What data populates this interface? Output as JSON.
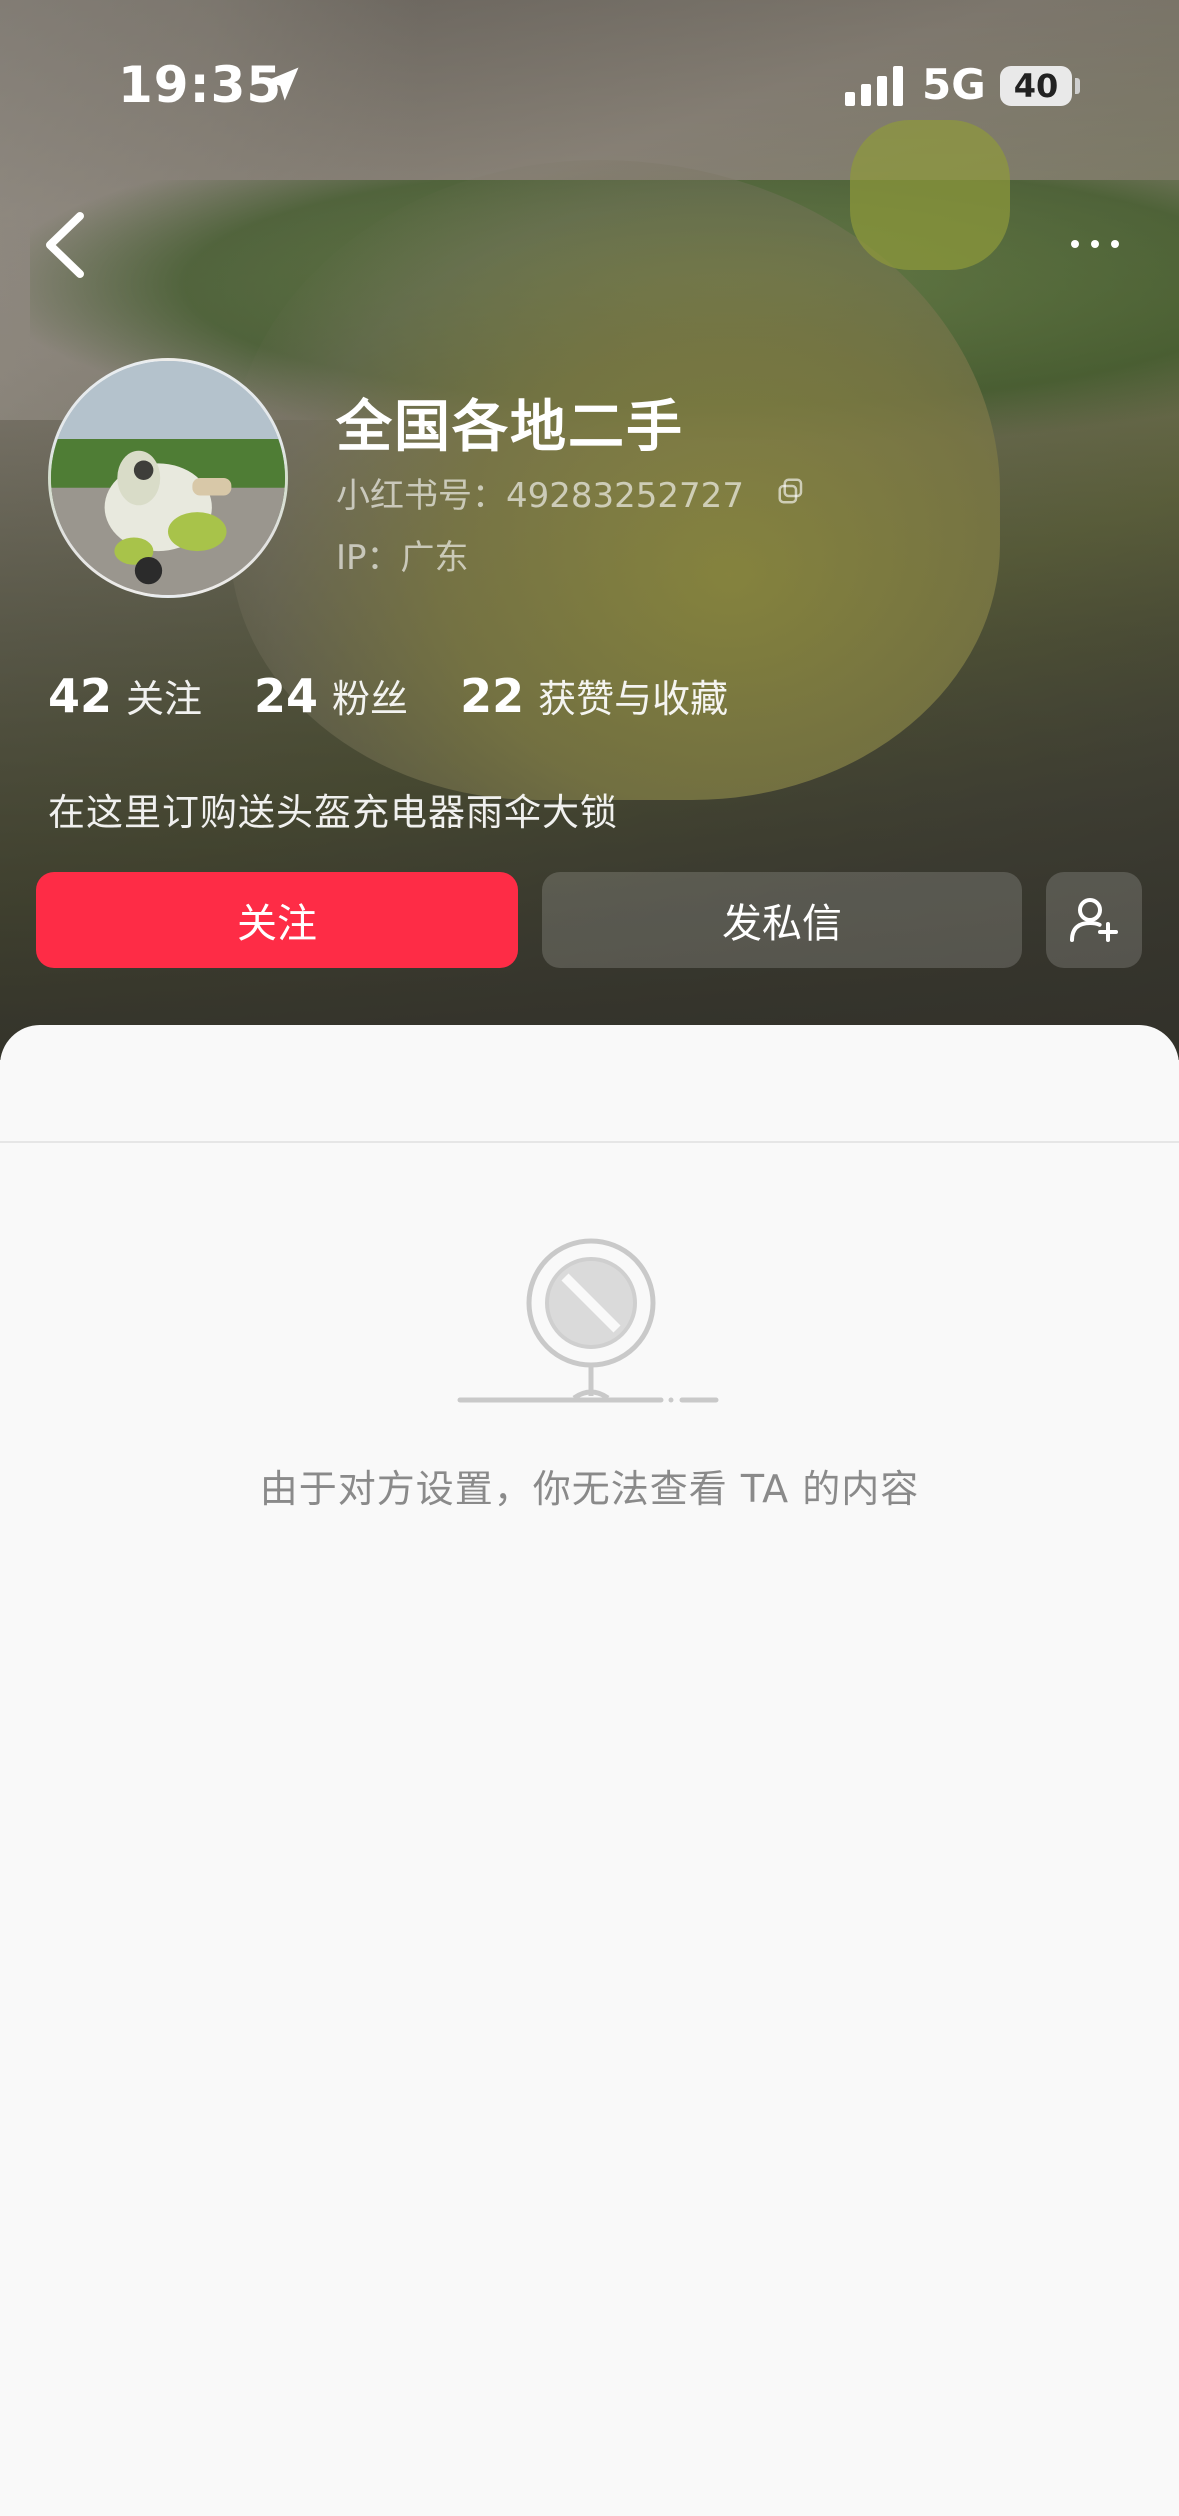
{
  "status_bar": {
    "time": "19:35",
    "network": "5G",
    "battery": "40",
    "icons": [
      "location-arrow-icon",
      "cellular-signal-icon",
      "battery-icon"
    ]
  },
  "nav": {
    "back_icon": "chevron-left-icon",
    "more_icon": "more-dots-icon"
  },
  "profile": {
    "nickname": "全国各地二手",
    "uid_label": "小红书号：",
    "uid": "49283252727",
    "ip_label": "IP：",
    "ip": "广东",
    "bio": "在这里订购送头盔充电器雨伞大锁"
  },
  "stats": [
    {
      "num": "42",
      "label": "关注"
    },
    {
      "num": "24",
      "label": "粉丝"
    },
    {
      "num": "22",
      "label": "获赞与收藏"
    }
  ],
  "actions": {
    "follow": "关注",
    "message": "发私信",
    "add_friend_icon": "add-user-icon"
  },
  "colors": {
    "accent": "#fe2c46",
    "sheet_bg": "#f9f9f9",
    "muted_text": "#8a8a8a"
  },
  "empty_state": {
    "icon": "blocked-sign-icon",
    "text": "由于对方设置，你无法查看 TA 的内容"
  }
}
